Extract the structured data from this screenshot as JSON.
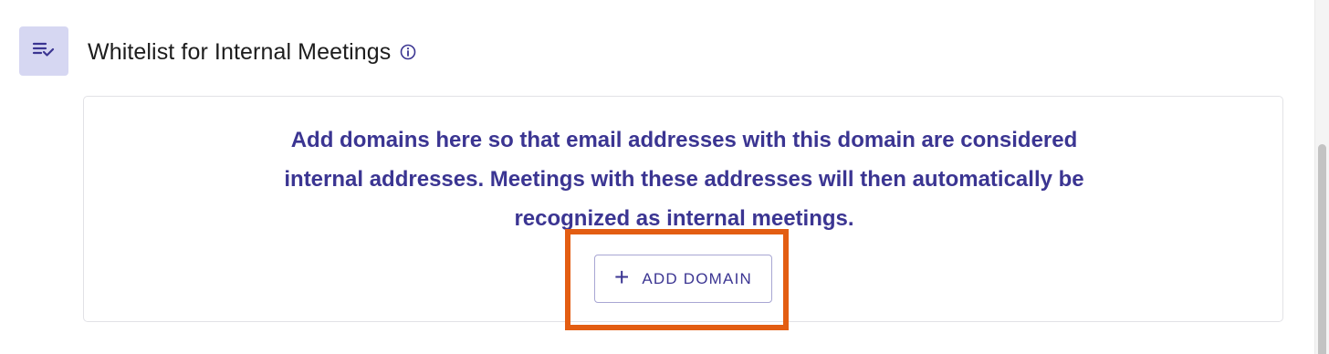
{
  "section": {
    "icon": "playlist-check-icon",
    "title": "Whitelist for Internal Meetings",
    "info_icon": "info-circle-icon"
  },
  "card": {
    "description": "Add domains here so that email addresses with this domain are considered internal addresses. Meetings with these addresses will then automatically be recognized as internal meetings.",
    "add_button": {
      "icon": "plus-icon",
      "plus_glyph": "+",
      "label": "ADD DOMAIN"
    }
  },
  "colors": {
    "accent": "#3b3592",
    "icon_bg": "#d6d7f2",
    "highlight": "#e35d12"
  }
}
